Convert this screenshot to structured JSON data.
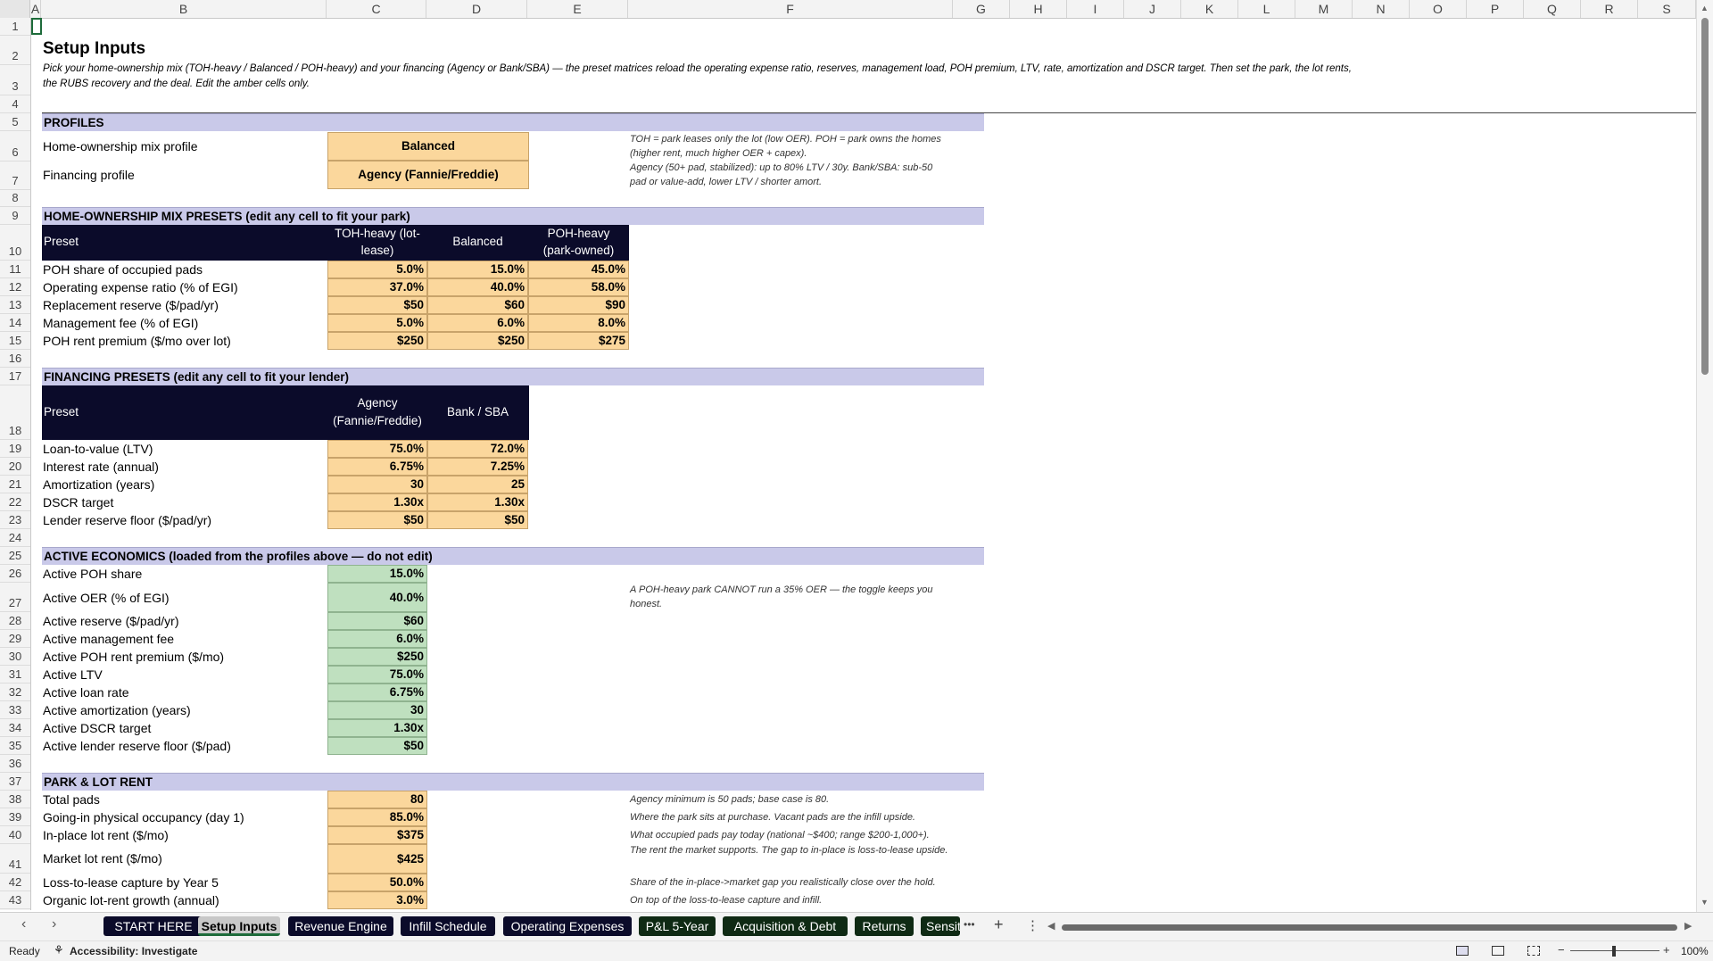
{
  "columns": [
    "A",
    "B",
    "C",
    "D",
    "E",
    "F",
    "G",
    "H",
    "I",
    "J",
    "K",
    "L",
    "M",
    "N",
    "O",
    "P",
    "Q",
    "R",
    "S"
  ],
  "rows": [
    "1",
    "2",
    "3",
    "4",
    "5",
    "6",
    "7",
    "8",
    "9",
    "10",
    "11",
    "12",
    "13",
    "14",
    "15",
    "16",
    "17",
    "18",
    "19",
    "20",
    "21",
    "22",
    "23",
    "24",
    "25",
    "26",
    "27",
    "28",
    "29",
    "30",
    "31",
    "32",
    "33",
    "34",
    "35",
    "36",
    "37",
    "38",
    "39",
    "40",
    "41",
    "42",
    "43"
  ],
  "header": {
    "title": "Setup Inputs",
    "intro_line1": "Pick your home-ownership mix (TOH-heavy / Balanced / POH-heavy) and your financing (Agency or Bank/SBA) — the preset matrices reload the operating expense ratio, reserves, management load, POH premium, LTV, rate, amortization and DSCR target. Then set the park, the lot rents,",
    "intro_line2": "the RUBS recovery and the deal. Edit the amber cells only."
  },
  "profiles": {
    "band": "PROFILES",
    "mix_label": "Home-ownership mix profile",
    "mix_value": "Balanced",
    "fin_label": "Financing profile",
    "fin_value": "Agency (Fannie/Freddie)",
    "note1": "TOH = park leases only the lot (low OER). POH = park owns the homes (higher rent, much higher OER + capex).",
    "note2": "Agency (50+ pad, stabilized): up to 80% LTV / 30y. Bank/SBA: sub-50 pad or value-add, lower LTV / shorter amort."
  },
  "mix_presets": {
    "band": "HOME-OWNERSHIP MIX PRESETS  (edit any cell to fit your park)",
    "head_preset": "Preset",
    "head_c1": "TOH-heavy (lot-",
    "head_c2": "lease)",
    "head_d": "Balanced",
    "head_e1": "POH-heavy",
    "head_e2": "(park-owned)",
    "rows": [
      {
        "label": "POH share of occupied pads",
        "c": "5.0%",
        "d": "15.0%",
        "e": "45.0%"
      },
      {
        "label": "Operating expense ratio (% of EGI)",
        "c": "37.0%",
        "d": "40.0%",
        "e": "58.0%"
      },
      {
        "label": "Replacement reserve ($/pad/yr)",
        "c": "$50",
        "d": "$60",
        "e": "$90"
      },
      {
        "label": "Management fee (% of EGI)",
        "c": "5.0%",
        "d": "6.0%",
        "e": "8.0%"
      },
      {
        "label": "POH rent premium ($/mo over lot)",
        "c": "$250",
        "d": "$250",
        "e": "$275"
      }
    ]
  },
  "fin_presets": {
    "band": "FINANCING PRESETS  (edit any cell to fit your lender)",
    "head_preset": "Preset",
    "head_c1": "Agency",
    "head_c2": "(Fannie/Freddie)",
    "head_d": "Bank / SBA",
    "rows": [
      {
        "label": "Loan-to-value (LTV)",
        "c": "75.0%",
        "d": "72.0%"
      },
      {
        "label": "Interest rate (annual)",
        "c": "6.75%",
        "d": "7.25%"
      },
      {
        "label": "Amortization (years)",
        "c": "30",
        "d": "25"
      },
      {
        "label": "DSCR target",
        "c": "1.30x",
        "d": "1.30x"
      },
      {
        "label": "Lender reserve floor ($/pad/yr)",
        "c": "$50",
        "d": "$50"
      }
    ]
  },
  "active": {
    "band": "ACTIVE ECONOMICS  (loaded from the profiles above — do not edit)",
    "note": "A POH-heavy park CANNOT run a 35% OER — the toggle keeps you honest.",
    "rows": [
      {
        "label": "Active POH share",
        "v": "15.0%"
      },
      {
        "label": "Active OER (% of EGI)",
        "v": "40.0%"
      },
      {
        "label": "Active reserve ($/pad/yr)",
        "v": "$60"
      },
      {
        "label": "Active management fee",
        "v": "6.0%"
      },
      {
        "label": "Active POH rent premium ($/mo)",
        "v": "$250"
      },
      {
        "label": "Active LTV",
        "v": "75.0%"
      },
      {
        "label": "Active loan rate",
        "v": "6.75%"
      },
      {
        "label": "Active amortization (years)",
        "v": "30"
      },
      {
        "label": "Active DSCR target",
        "v": "1.30x"
      },
      {
        "label": "Active lender reserve floor ($/pad)",
        "v": "$50"
      }
    ]
  },
  "park": {
    "band": "PARK & LOT RENT",
    "rows": [
      {
        "label": "Total pads",
        "v": "80",
        "note": "Agency minimum is 50 pads; base case is 80."
      },
      {
        "label": "Going-in physical occupancy (day 1)",
        "v": "85.0%",
        "note": "Where the park sits at purchase. Vacant pads are the infill upside."
      },
      {
        "label": "In-place lot rent ($/mo)",
        "v": "$375",
        "note": "What occupied pads pay today (national ~$400; range $200-1,000+)."
      },
      {
        "label": "Market lot rent ($/mo)",
        "v": "$425",
        "note": "The rent the market supports. The gap to in-place is loss-to-lease upside."
      },
      {
        "label": "Loss-to-lease capture by Year 5",
        "v": "50.0%",
        "note": "Share of the in-place->market gap you realistically close over the hold."
      },
      {
        "label": "Organic lot-rent growth (annual)",
        "v": "3.0%",
        "note": "On top of the loss-to-lease capture and infill."
      }
    ]
  },
  "tabs": [
    {
      "label": "START HERE"
    },
    {
      "label": "Setup Inputs"
    },
    {
      "label": "Revenue Engine"
    },
    {
      "label": "Infill Schedule"
    },
    {
      "label": "Operating Expenses"
    },
    {
      "label": "P&L 5-Year"
    },
    {
      "label": "Acquisition & Debt"
    },
    {
      "label": "Returns"
    },
    {
      "label": "Sensit"
    }
  ],
  "tabbar": {
    "more": "•••",
    "add": "+",
    "menu": "⋮"
  },
  "status": {
    "ready": "Ready",
    "accessibility": "Accessibility: Investigate",
    "zoom": "100%"
  },
  "colors": {
    "amber": "#fbd79c",
    "green": "#bfe0bf",
    "navy": "#0b0b2a",
    "band": "#c9c9e9",
    "tab_dark": "#0b0b2a",
    "tab_green": "#0f2a14"
  }
}
